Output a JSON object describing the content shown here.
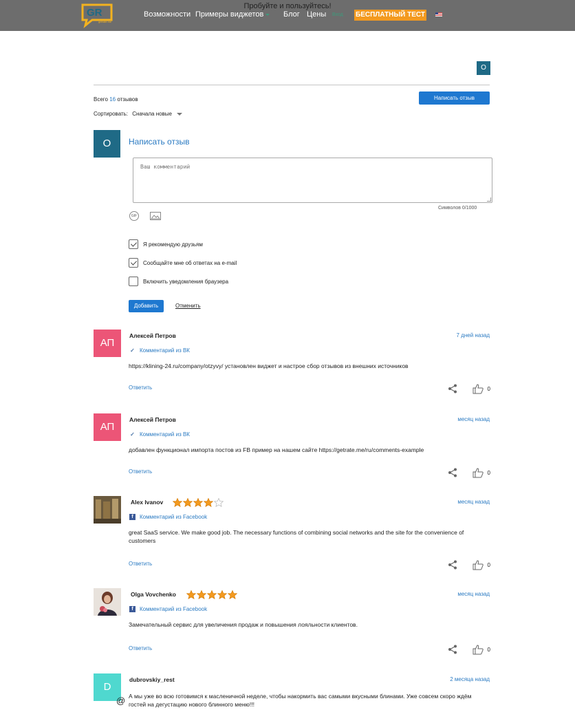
{
  "header": {
    "promo": "Пробуйте и пользуйтесь!",
    "nav": [
      "Возможности",
      "Примеры виджетов",
      "Блог",
      "Цены"
    ],
    "login": "Вход",
    "cta": "БЕСПЛАТНЫЙ ТЕСТ",
    "logo_text": "GR",
    "logo_sub": "getrate.me"
  },
  "user_initial": "O",
  "summary": {
    "prefix": "Всего",
    "count": "16",
    "suffix": "отзывов",
    "write_button": "Написать отзыв"
  },
  "sort": {
    "label": "Сортировать:",
    "value": "Сначала новые"
  },
  "form": {
    "avatar": "O",
    "title": "Написать отзыв",
    "placeholder": "Ваш комментарий",
    "counter": "Символов 0/1000",
    "gif_label": "GIF",
    "checkboxes": [
      {
        "label": "Я рекомендую друзьям",
        "checked": true
      },
      {
        "label": "Сообщайте мне об ответах на e-mail",
        "checked": true
      },
      {
        "label": "Включить уведомления браузера",
        "checked": false
      }
    ],
    "submit": "Добавить",
    "cancel": "Отменить"
  },
  "colors": {
    "accent": "#1e78d0",
    "link": "#2a7ac2",
    "cta": "#f39a1f",
    "star": "#f39a1f"
  },
  "reviews": [
    {
      "name": "Алексей Петров",
      "initials": "АП",
      "avatar_color": "#ec5577",
      "date": "7 дней назад",
      "source": "Комментарий из ВК",
      "source_type": "vk",
      "text": "https://klining-24.ru/company/otzyvy/ установлен виджет и настрое сбор отзывов из внешних источников",
      "reply": "Ответить",
      "likes": "0"
    },
    {
      "name": "Алексей Петров",
      "initials": "АП",
      "avatar_color": "#ec5577",
      "date": "месяц назад",
      "source": "Комментарий из ВК",
      "source_type": "vk",
      "text": "добавлен функционал импорта постов из FB пример на нашем сайте https://getrate.me/ru/comments-example",
      "reply": "Ответить",
      "likes": "0"
    },
    {
      "name": "Alex Ivanov",
      "rating": 4,
      "date": "месяц назад",
      "source": "Комментарий из Facebook",
      "source_type": "facebook",
      "text": "great SaaS service. We make good job. The necessary functions of combining social networks and the site for the convenience of customers",
      "reply": "Ответить",
      "likes": "0"
    },
    {
      "name": "Olga Vovchenko",
      "rating": 5,
      "date": "месяц назад",
      "source": "Комментарий из Facebook",
      "source_type": "facebook",
      "text": "Замечательный сервис для увеличения продаж и повышения лояльности клиентов.",
      "reply": "Ответить",
      "likes": "0"
    },
    {
      "name": "dubrovskiy_rest",
      "initials": "D",
      "avatar_color": "#4fd8cf",
      "date": "2 месяца назад",
      "text": "А мы уже во всю готовимся к масленичной неделе, чтобы накормить вас самыми вкусными блинами. Уже совсем скоро ждём гостей на дегустацию нового блинного меню!!!"
    }
  ]
}
